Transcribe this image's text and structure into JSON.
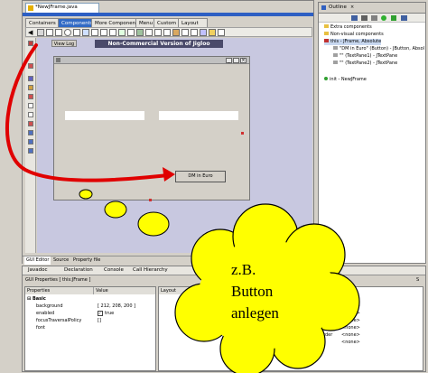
{
  "editor": {
    "file_tab": "*NewJFrame.java",
    "palette_tabs": [
      "Containers",
      "Components",
      "More Components",
      "Menu",
      "Custom",
      "Layout"
    ],
    "watermark": "Non-Commercial Version of Jigloo",
    "view_log": "View Log",
    "form_button": "DM in Euro",
    "bottom_tabs": [
      "GUI Editor",
      "Source",
      "Property file"
    ]
  },
  "outline": {
    "tab": "Outline",
    "items": [
      "Extra components",
      "Non-visual components",
      "this - JFrame, Absolute",
      "\"DM in Euro\" (Button) - JButton, Absol",
      "\"\" (TextPane1) - JTextPane",
      "\"\" (TextPane2) - JTextPane",
      "init - NewJFrame"
    ]
  },
  "lower_panel": {
    "tabs": [
      "Javadoc",
      "Declaration",
      "Console",
      "Call Hierarchy"
    ],
    "gui_properties": "GUI Properties [ this:JFrame ]",
    "col_properties": "Properties",
    "col_value": "Value",
    "col_layout": "Layout",
    "section": "Basic",
    "rows": [
      {
        "name": "background",
        "value": "[ 212, 208, 200 ]"
      },
      {
        "name": "enabled",
        "value": "true"
      },
      {
        "name": "focusTraversalPolicy",
        "value": "[]"
      },
      {
        "name": "font",
        "value": ""
      }
    ],
    "none_values": [
      "<none>",
      "<none>",
      "<none>",
      "<none>",
      "<none>",
      "<none>"
    ],
    "partial_labels": [
      "rder",
      "rder"
    ],
    "right_initial": "S"
  },
  "cloud": {
    "lines": [
      "z.B.",
      "Button",
      "anlegen"
    ],
    "fill": "#ffff00"
  },
  "colors": {
    "arrow": "#e00000",
    "title_blue": "#2d5fc3",
    "canvas": "#c8c8e0"
  }
}
